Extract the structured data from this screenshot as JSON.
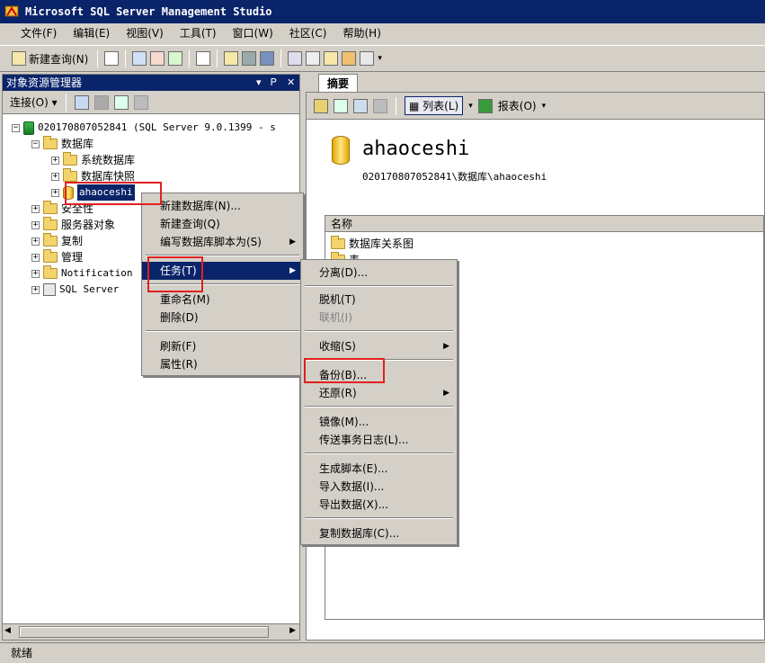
{
  "window": {
    "title": "Microsoft SQL Server Management Studio"
  },
  "menubar": [
    "文件(F)",
    "编辑(E)",
    "视图(V)",
    "工具(T)",
    "窗口(W)",
    "社区(C)",
    "帮助(H)"
  ],
  "toolbar": {
    "new_query": "新建查询(N)"
  },
  "object_explorer": {
    "title": "对象资源管理器",
    "pin_controls": "▾ ᵖ ✕",
    "connect": "连接(O) ▾",
    "server": "020170807052841 (SQL Server 9.0.1399 - s",
    "databases": "数据库",
    "system_dbs": "系统数据库",
    "db_snapshots": "数据库快照",
    "db_selected": "ahaoceshi",
    "security": "安全性",
    "server_objects": "服务器对象",
    "replication": "复制",
    "management": "管理",
    "notification": "Notification",
    "agent": "SQL Server"
  },
  "summary": {
    "tab": "摘要",
    "list_button": "列表(L)",
    "report_button": "报表(O)",
    "db_name": "ahaoceshi",
    "path": "020170807052841\\数据库\\ahaoceshi",
    "col_name": "名称",
    "rows": [
      "数据库关系图",
      "表"
    ]
  },
  "context_menu": {
    "new_db": "新建数据库(N)...",
    "new_query": "新建查询(Q)",
    "script_db": "编写数据库脚本为(S)",
    "tasks": "任务(T)",
    "rename": "重命名(M)",
    "delete": "删除(D)",
    "refresh": "刷新(F)",
    "properties": "属性(R)"
  },
  "tasks_menu": {
    "detach": "分离(D)...",
    "offline": "脱机(T)",
    "online": "联机(I)",
    "shrink": "收缩(S)",
    "backup": "备份(B)...",
    "restore": "还原(R)",
    "mirror": "镜像(M)...",
    "log_shipping": "传送事务日志(L)...",
    "gen_scripts": "生成脚本(E)...",
    "import": "导入数据(I)...",
    "export": "导出数据(X)...",
    "copy_db": "复制数据库(C)..."
  },
  "status": "就绪",
  "colors": {
    "titlebar": "#0a246a",
    "highlight": "#0a246a",
    "annotation": "#e02020"
  }
}
